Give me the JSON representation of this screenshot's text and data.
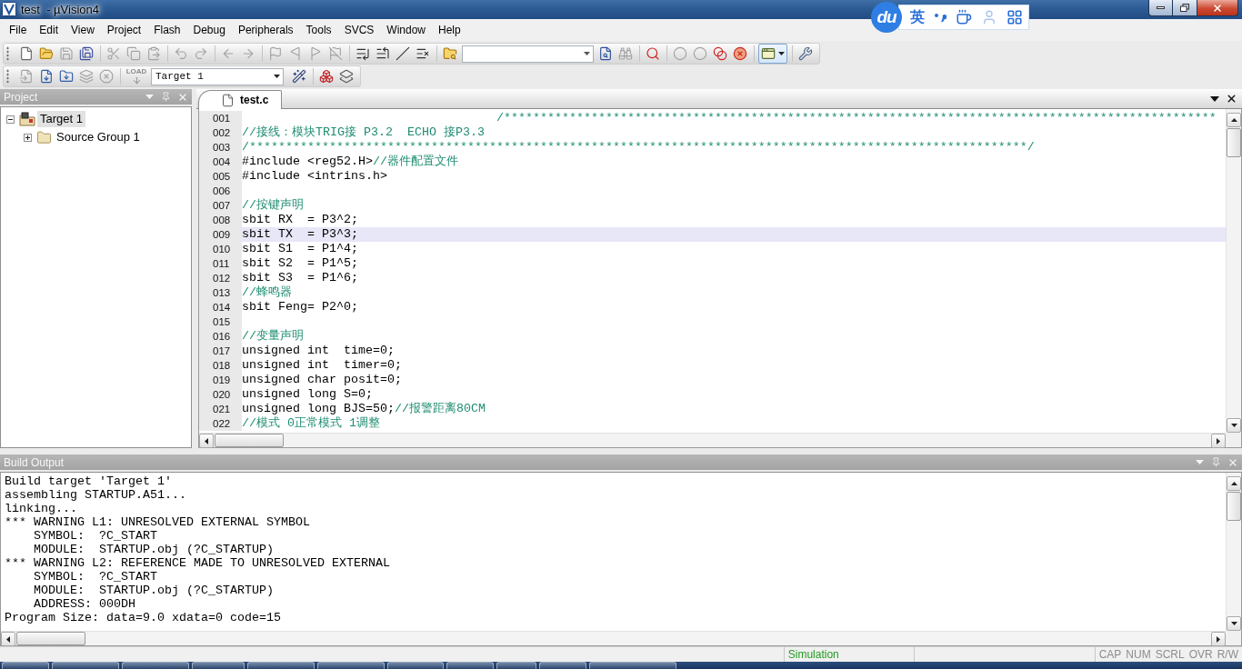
{
  "window": {
    "title": "test  - µVision4"
  },
  "ime_bar": {
    "logo": "du",
    "mode": "英"
  },
  "menu": [
    "File",
    "Edit",
    "View",
    "Project",
    "Flash",
    "Debug",
    "Peripherals",
    "Tools",
    "SVCS",
    "Window",
    "Help"
  ],
  "toolbars": [
    [
      {
        "kind": "new",
        "disabled": false
      },
      {
        "kind": "open",
        "disabled": false
      },
      {
        "kind": "save",
        "disabled": true
      },
      {
        "kind": "save-all",
        "disabled": false
      },
      {
        "kind": "separator"
      },
      {
        "kind": "cut",
        "disabled": true
      },
      {
        "kind": "copy",
        "disabled": true
      },
      {
        "kind": "paste",
        "disabled": true
      },
      {
        "kind": "separator"
      },
      {
        "kind": "undo",
        "disabled": true
      },
      {
        "kind": "redo",
        "disabled": true
      },
      {
        "kind": "separator"
      },
      {
        "kind": "back",
        "disabled": true
      },
      {
        "kind": "forward",
        "disabled": true
      },
      {
        "kind": "separator"
      },
      {
        "kind": "bookmark",
        "disabled": true
      },
      {
        "kind": "bookmark-prev",
        "disabled": true
      },
      {
        "kind": "bookmark-next",
        "disabled": true
      },
      {
        "kind": "bookmark-clear",
        "disabled": true
      },
      {
        "kind": "separator"
      },
      {
        "kind": "indent",
        "disabled": false
      },
      {
        "kind": "unindent",
        "disabled": false
      },
      {
        "kind": "comment",
        "disabled": false
      },
      {
        "kind": "uncomment",
        "disabled": false
      },
      {
        "kind": "separator"
      },
      {
        "kind": "find-in-files",
        "disabled": false
      },
      {
        "kind": "search-combo"
      },
      {
        "kind": "find",
        "disabled": false
      },
      {
        "kind": "incremental-find",
        "disabled": true
      },
      {
        "kind": "separator"
      },
      {
        "kind": "debug",
        "disabled": false
      },
      {
        "kind": "separator"
      },
      {
        "kind": "breakpoint",
        "disabled": true
      },
      {
        "kind": "breakpoint-enable",
        "disabled": true
      },
      {
        "kind": "breakpoints-disable",
        "disabled": false
      },
      {
        "kind": "breakpoints-kill",
        "disabled": false
      },
      {
        "kind": "separator"
      },
      {
        "kind": "layout",
        "disabled": false
      },
      {
        "kind": "separator"
      },
      {
        "kind": "configure",
        "disabled": false
      }
    ],
    [
      {
        "kind": "translate",
        "disabled": true
      },
      {
        "kind": "build",
        "disabled": false
      },
      {
        "kind": "rebuild",
        "disabled": false
      },
      {
        "kind": "batch-build",
        "disabled": true
      },
      {
        "kind": "stop-build",
        "disabled": true
      },
      {
        "kind": "separator"
      },
      {
        "kind": "load",
        "label": "LOAD",
        "disabled": true
      },
      {
        "kind": "target-select",
        "value": "Target 1"
      },
      {
        "kind": "options",
        "disabled": false
      },
      {
        "kind": "separator"
      },
      {
        "kind": "manage",
        "disabled": false
      },
      {
        "kind": "packs",
        "disabled": false
      }
    ]
  ],
  "project": {
    "title": "Project",
    "tree": [
      {
        "kind": "target",
        "label": "Target 1",
        "expanded": true,
        "selected": true,
        "children": [
          {
            "kind": "group",
            "label": "Source Group 1",
            "expanded": false,
            "selected": false
          }
        ]
      }
    ]
  },
  "editor": {
    "tabs": [
      {
        "label": "test.c",
        "selected": true
      }
    ],
    "lines": [
      {
        "number": "001",
        "comment": "                                   /**************************************************************************************************",
        "current": false
      },
      {
        "number": "002",
        "comment": "//接线：模块TRIG接 P3.2  ECHO 接P3.3",
        "current": false
      },
      {
        "number": "003",
        "comment": "/***********************************************************************************************************/",
        "current": false
      },
      {
        "number": "004",
        "code": "#include <reg52.H>",
        "comment": "//器件配置文件",
        "current": false
      },
      {
        "number": "005",
        "code": "#include <intrins.h>",
        "current": false
      },
      {
        "number": "006",
        "current": false
      },
      {
        "number": "007",
        "comment": "//按键声明",
        "current": false
      },
      {
        "number": "008",
        "code": "sbit RX  = P3^2;",
        "current": false
      },
      {
        "number": "009",
        "code": "sbit TX  = P3^3;",
        "current": true
      },
      {
        "number": "010",
        "code": "sbit S1  = P1^4;",
        "current": false
      },
      {
        "number": "011",
        "code": "sbit S2  = P1^5;",
        "current": false
      },
      {
        "number": "012",
        "code": "sbit S3  = P1^6;",
        "current": false
      },
      {
        "number": "013",
        "comment": "//蜂鸣器",
        "current": false
      },
      {
        "number": "014",
        "code": "sbit Feng= P2^0;",
        "current": false
      },
      {
        "number": "015",
        "current": false
      },
      {
        "number": "016",
        "comment": "//变量声明",
        "current": false
      },
      {
        "number": "017",
        "code": "unsigned int  time=0;",
        "current": false
      },
      {
        "number": "018",
        "code": "unsigned int  timer=0;",
        "current": false
      },
      {
        "number": "019",
        "code": "unsigned char posit=0;",
        "current": false
      },
      {
        "number": "020",
        "code": "unsigned long S=0;",
        "current": false
      },
      {
        "number": "021",
        "code": "unsigned long BJS=50;",
        "comment": "//报警距离80CM",
        "current": false
      },
      {
        "number": "022",
        "comment": "//模式 0正常模式 1调整",
        "current": false
      }
    ]
  },
  "build_output": {
    "title": "Build Output",
    "lines": [
      "Build target 'Target 1'",
      "assembling STARTUP.A51...",
      "linking...",
      "*** WARNING L1: UNRESOLVED EXTERNAL SYMBOL",
      "    SYMBOL:  ?C_START",
      "    MODULE:  STARTUP.obj (?C_STARTUP)",
      "*** WARNING L2: REFERENCE MADE TO UNRESOLVED EXTERNAL",
      "    SYMBOL:  ?C_START",
      "    MODULE:  STARTUP.obj (?C_STARTUP)",
      "    ADDRESS: 000DH",
      "Program Size: data=9.0 xdata=0 code=15"
    ]
  },
  "status_bar": {
    "mode": "Simulation",
    "indicators": [
      {
        "label": "CAP",
        "on": false
      },
      {
        "label": "NUM",
        "on": false
      },
      {
        "label": "SCRL",
        "on": false
      },
      {
        "label": "OVR",
        "on": false
      },
      {
        "label": "R/W",
        "on": false
      }
    ]
  }
}
